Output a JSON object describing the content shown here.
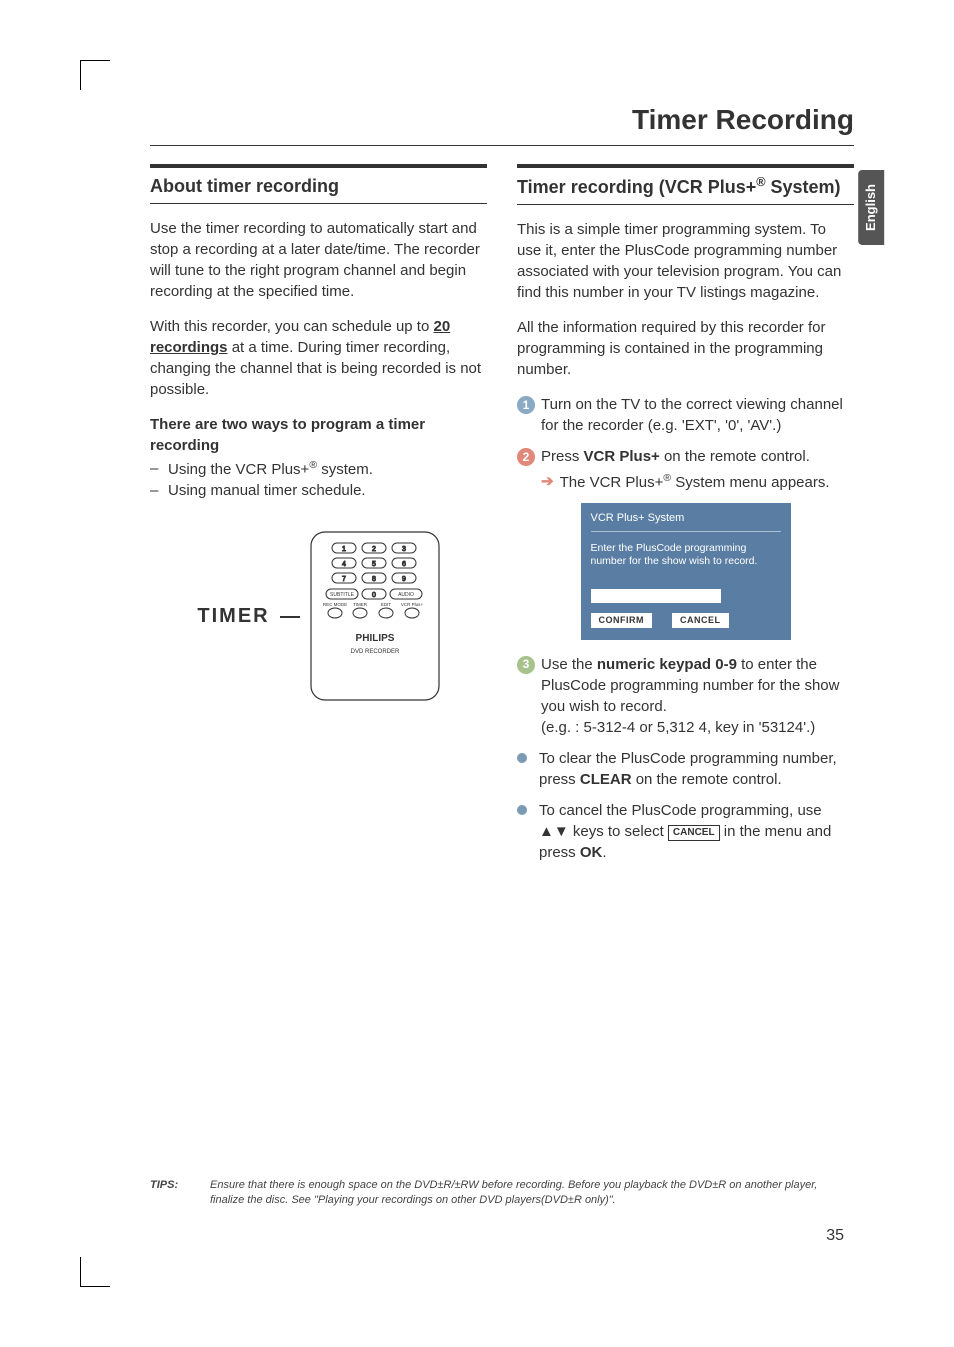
{
  "page_title": "Timer Recording",
  "language_tab": "English",
  "page_number": "35",
  "left": {
    "heading": "About timer recording",
    "p1_a": "Use the timer recording to automatically start and stop a recording at a later date/time. The recorder will tune to the right program channel and begin recording at the specified time.",
    "p2_a": "With this recorder, you can schedule up to ",
    "p2_bold": "20 recordings",
    "p2_b": " at a time. During timer recording, changing the channel that is being recorded is not possible.",
    "subhead": "There are two ways to program a timer recording",
    "bullets": [
      {
        "pre": "Using the VCR Plus+",
        "sup": "®",
        "post": " system."
      },
      {
        "pre": "Using manual timer schedule.",
        "sup": "",
        "post": ""
      }
    ],
    "timer_label": "TIMER",
    "remote_brand": "PHILIPS",
    "remote_sub": "DVD RECORDER",
    "remote_row_labels": [
      "SUBTITLE",
      "AUDIO"
    ],
    "remote_small_labels": [
      "REC MODE",
      "TIMER",
      "EDIT",
      "VCR Plus+"
    ]
  },
  "right": {
    "heading_a": "Timer recording (VCR Plus+",
    "heading_sup": "®",
    "heading_b": " System)",
    "p1": "This is a simple timer programming system. To use it, enter the PlusCode programming number associated with your television program. You can find this number in your TV listings magazine.",
    "p2": "All the information required by this recorder for programming is contained in the programming number.",
    "step1": "Turn on the TV to the correct viewing channel for the recorder (e.g. 'EXT', '0', 'AV'.)",
    "step2_a": "Press ",
    "step2_bold": "VCR Plus+",
    "step2_b": " on the remote control.",
    "step2_result_a": "The VCR Plus+",
    "step2_result_sup": "®",
    "step2_result_b": " System menu appears.",
    "dialog": {
      "title": "VCR Plus+ System",
      "instruction": "Enter the PlusCode programming number for the show wish to record.",
      "confirm": "CONFIRM",
      "cancel": "CANCEL"
    },
    "step3_a": "Use the ",
    "step3_bold": "numeric keypad 0-9",
    "step3_b": " to enter the PlusCode programming number for the show you wish to record.",
    "step3_eg": "(e.g. : 5-312-4 or 5,312 4, key in '53124'.)",
    "bullet1_a": "To clear the PlusCode programming number, press ",
    "bullet1_bold": "CLEAR",
    "bullet1_b": " on the remote control.",
    "bullet2_a": "To cancel the PlusCode programming, use ▲▼ keys to select ",
    "bullet2_cancel": "CANCEL",
    "bullet2_b": " in the menu and press ",
    "bullet2_bold": "OK",
    "bullet2_c": "."
  },
  "tips": {
    "label": "TIPS:",
    "text": "Ensure that there is enough space on the DVD±R/±RW before recording. Before you playback the DVD±R on another player, finalize the disc. See \"Playing your recordings on other DVD players(DVD±R only)\"."
  }
}
